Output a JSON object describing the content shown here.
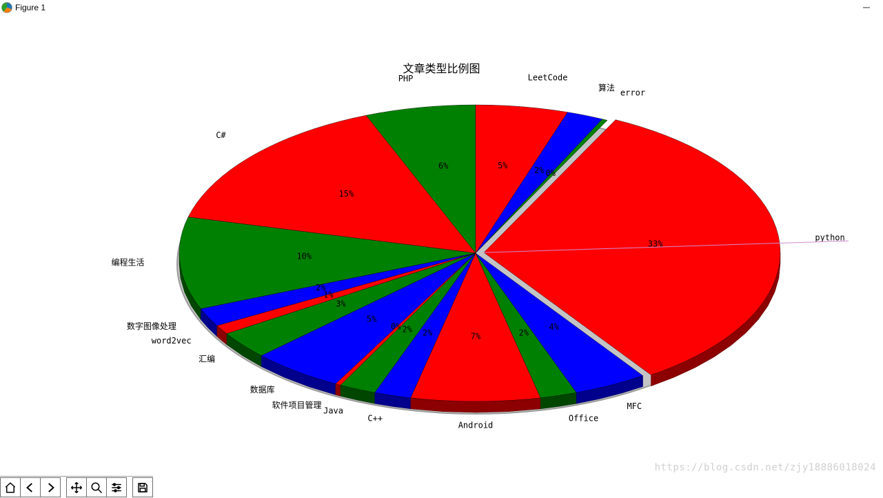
{
  "window": {
    "title": "Figure 1"
  },
  "chart_data": {
    "type": "pie",
    "title": "文章类型比例图",
    "start_angle_deg": 90,
    "direction": "ccw",
    "slices": [
      {
        "label": "PHP",
        "value": 6,
        "percent": "6%",
        "color": "#008002"
      },
      {
        "label": "C#",
        "value": 15,
        "percent": "15%",
        "color": "#FF0002"
      },
      {
        "label": "编程生活",
        "value": 10,
        "percent": "10%",
        "color": "#008002"
      },
      {
        "label": "数字图像处理",
        "value": 2,
        "percent": "2%",
        "color": "#0000FF"
      },
      {
        "label": "word2vec",
        "value": 1,
        "percent": "1%",
        "color": "#FF0002"
      },
      {
        "label": "汇编",
        "value": 3,
        "percent": "3%",
        "color": "#008002"
      },
      {
        "label": "数据库",
        "value": 5,
        "percent": "5%",
        "color": "#0000FF"
      },
      {
        "label": "软件项目管理",
        "value": 0,
        "percent": "0%",
        "color": "#FF0002"
      },
      {
        "label": "Java",
        "value": 2,
        "percent": "2%",
        "color": "#008002"
      },
      {
        "label": "C++",
        "value": 2,
        "percent": "2%",
        "color": "#0000FF"
      },
      {
        "label": "Android",
        "value": 7,
        "percent": "7%",
        "color": "#FF0002"
      },
      {
        "label": "Office",
        "value": 2,
        "percent": "2%",
        "color": "#008002"
      },
      {
        "label": "MFC",
        "value": 4,
        "percent": "4%",
        "color": "#0000FF"
      },
      {
        "label": "python",
        "value": 33,
        "percent": "33%",
        "color": "#FF0002"
      },
      {
        "label": "error",
        "value": 0,
        "percent": "0%",
        "color": "#008002"
      },
      {
        "label": "算法",
        "value": 2,
        "percent": "2%",
        "color": "#0000FF"
      },
      {
        "label": "LeetCode",
        "value": 5,
        "percent": "5%",
        "color": "#FF0002"
      }
    ]
  },
  "toolbar": {
    "buttons": [
      {
        "name": "home-button",
        "icon": "home-icon"
      },
      {
        "name": "back-button",
        "icon": "arrow-left-icon"
      },
      {
        "name": "forward-button",
        "icon": "arrow-right-icon"
      },
      {
        "name": "pan-button",
        "icon": "move-icon"
      },
      {
        "name": "zoom-button",
        "icon": "magnifier-icon"
      },
      {
        "name": "configure-button",
        "icon": "sliders-icon"
      },
      {
        "name": "save-button",
        "icon": "floppy-icon"
      }
    ]
  },
  "watermark": "https://blog.csdn.net/zjy18886018024"
}
